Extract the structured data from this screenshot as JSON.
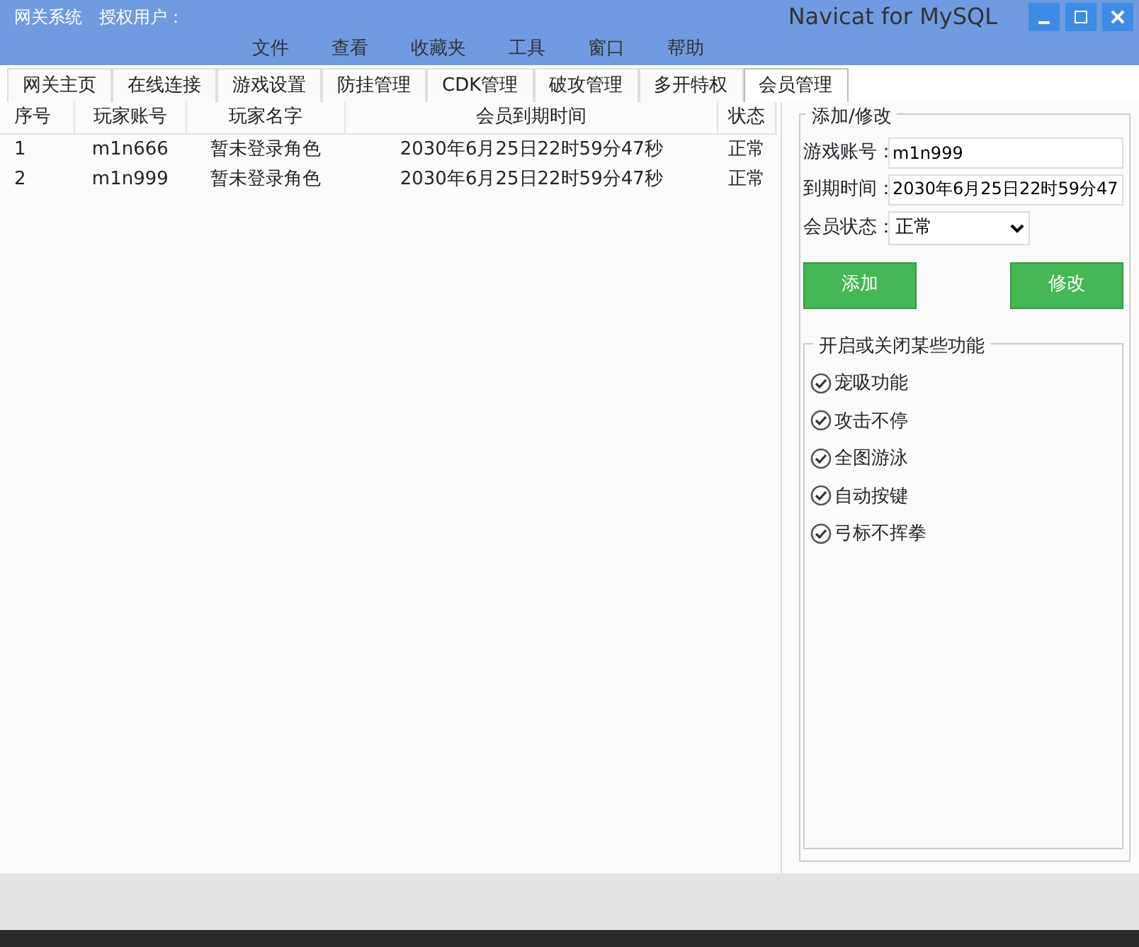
{
  "window": {
    "title": "网关系统",
    "user_label": "授权用户：",
    "background_title": "Navicat for MySQL"
  },
  "background_menu": [
    "文件",
    "查看",
    "收藏夹",
    "工具",
    "窗口",
    "帮助"
  ],
  "tabs": [
    {
      "label": "网关主页",
      "selected": false
    },
    {
      "label": "在线连接",
      "selected": false
    },
    {
      "label": "游戏设置",
      "selected": false
    },
    {
      "label": "防挂管理",
      "selected": false
    },
    {
      "label": "CDK管理",
      "selected": false
    },
    {
      "label": "破攻管理",
      "selected": false
    },
    {
      "label": "多开特权",
      "selected": false
    },
    {
      "label": "会员管理",
      "selected": true
    }
  ],
  "table": {
    "columns": [
      "序号",
      "玩家账号",
      "玩家名字",
      "会员到期时间",
      "状态"
    ],
    "rows": [
      [
        "1",
        "m1n666",
        "暂未登录角色",
        "2030年6月25日22时59分47秒",
        "正常"
      ],
      [
        "2",
        "m1n999",
        "暂未登录角色",
        "2030年6月25日22时59分47秒",
        "正常"
      ]
    ]
  },
  "edit_panel": {
    "title": "添加/修改",
    "fields": [
      {
        "label": "游戏账号：",
        "value": "m1n999",
        "kind": "text"
      },
      {
        "label": "到期时间：",
        "value": "2030年6月25日22时59分47",
        "kind": "text"
      },
      {
        "label": "会员状态：",
        "value": "正常",
        "kind": "select"
      }
    ],
    "buttons": [
      "添加",
      "修改"
    ]
  },
  "features": {
    "title": "开启或关闭某些功能",
    "items": [
      {
        "label": "宠吸功能",
        "checked": true
      },
      {
        "label": "攻击不停",
        "checked": true
      },
      {
        "label": "全图游泳",
        "checked": true
      },
      {
        "label": "自动按键",
        "checked": true
      },
      {
        "label": "弓标不挥拳",
        "checked": true
      }
    ]
  }
}
